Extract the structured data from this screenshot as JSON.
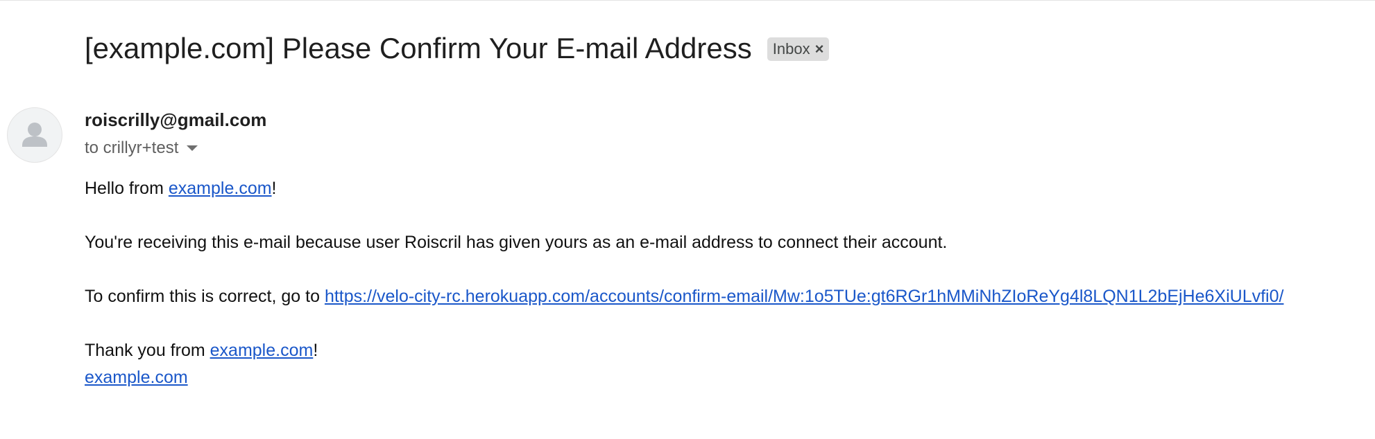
{
  "email": {
    "subject": "[example.com] Please Confirm Your E-mail Address",
    "label": "Inbox",
    "label_close": "×",
    "sender": "roiscrilly@gmail.com",
    "recipient": "to crillyr+test",
    "body": {
      "greeting_prefix": "Hello from ",
      "greeting_link": "example.com",
      "greeting_suffix": "!",
      "reason": "You're receiving this e-mail because user Roiscril has given yours as an e-mail address to connect their account.",
      "confirm_prefix": "To confirm this is correct, go to ",
      "confirm_link": "https://velo-city-rc.herokuapp.com/accounts/confirm-email/Mw:1o5TUe:gt6RGr1hMMiNhZIoReYg4l8LQN1L2bEjHe6XiULvfi0/",
      "thanks_prefix": "Thank you from ",
      "thanks_link": "example.com",
      "thanks_suffix": "!",
      "signature_link": "example.com"
    }
  },
  "icons": {
    "avatar": "person-icon",
    "label_remove": "close-icon",
    "recipient_details": "chevron-down-icon"
  },
  "colors": {
    "link": "#1a57c9",
    "label_chip_bg": "#dddddd",
    "avatar_bg": "#f1f3f4"
  }
}
